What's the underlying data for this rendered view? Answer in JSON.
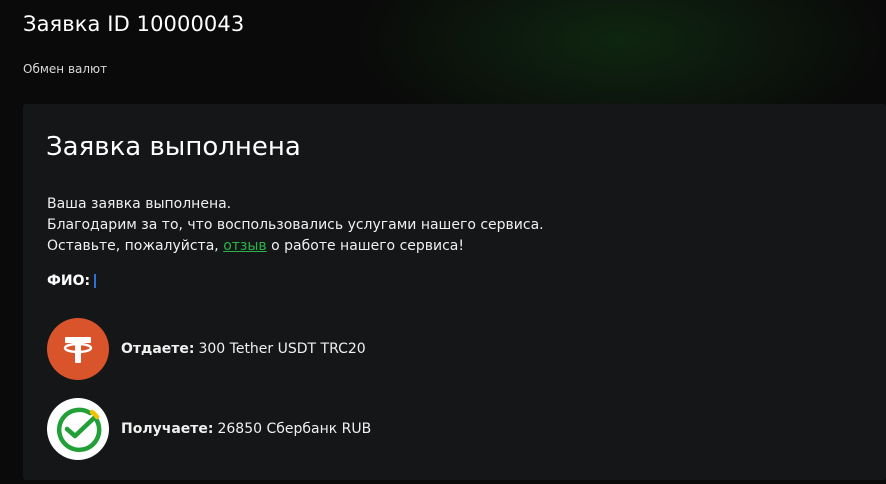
{
  "header": {
    "title": "Заявка ID 10000043",
    "breadcrumb": "Обмен валют"
  },
  "card": {
    "title": "Заявка выполнена",
    "message_line1": "Ваша заявка выполнена.",
    "message_line2": "Благодарим за то, что воспользовались услугами нашего сервиса.",
    "message_line3_before": "Оставьте, пожалуйста,",
    "message_line3_link": "отзыв",
    "message_line3_after": "о работе нашего сервиса!",
    "fio_label": "ФИО:",
    "fio_value": ""
  },
  "exchange": {
    "give": {
      "label": "Отдаете:",
      "value": "300 Tether USDT TRC20",
      "icon": "tether-icon"
    },
    "get": {
      "label": "Получаете:",
      "value": "26850 Сбербанк RUB",
      "icon": "sberbank-icon"
    }
  },
  "colors": {
    "background": "#0a0a0a",
    "card": "#151618",
    "link": "#2bb34a",
    "tether": "#d9542a",
    "sber_green": "#21a038"
  }
}
